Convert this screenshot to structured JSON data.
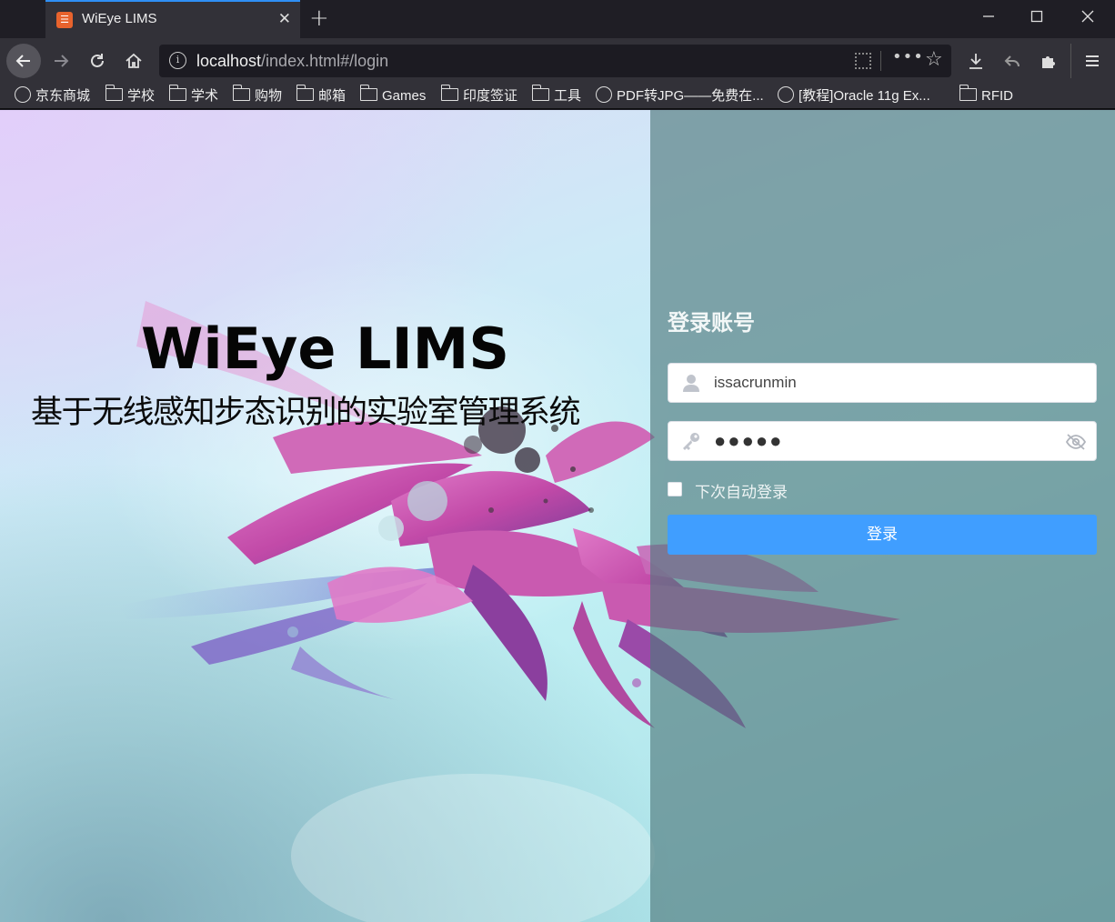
{
  "browser": {
    "tab_title": "WiEye LIMS",
    "tab_close": "✕",
    "new_tab": "+",
    "favicon_text": "☒",
    "window_controls": {
      "minimize": "—",
      "maximize": "☐",
      "close": "✕"
    },
    "url": {
      "host": "localhost",
      "path": "/index.html#/login"
    },
    "nav_icons": {
      "back": "←",
      "forward": "→",
      "reload": "↻",
      "home": "⌂",
      "more": "•••",
      "star": "☆",
      "download": "⤓",
      "undo": "↶",
      "extensions": "✚",
      "menu": "☰"
    },
    "bookmarks": [
      {
        "label": "京东商城",
        "icon": "globe-icon"
      },
      {
        "label": "学校",
        "icon": "folder-icon"
      },
      {
        "label": "学术",
        "icon": "folder-icon"
      },
      {
        "label": "购物",
        "icon": "folder-icon"
      },
      {
        "label": "邮箱",
        "icon": "folder-icon"
      },
      {
        "label": "Games",
        "icon": "folder-icon"
      },
      {
        "label": "印度签证",
        "icon": "folder-icon"
      },
      {
        "label": "工具",
        "icon": "folder-icon"
      },
      {
        "label": "PDF转JPG——免费在...",
        "icon": "globe-icon"
      },
      {
        "label": "[教程]Oracle 11g Ex...",
        "icon": "globe-icon"
      },
      {
        "label": "RFID",
        "icon": "folder-icon"
      }
    ]
  },
  "hero": {
    "title": "WiEye LIMS",
    "subtitle": "基于无线感知步态识别的实验室管理系统"
  },
  "login": {
    "heading": "登录账号",
    "username_value": "issacrunmin",
    "password_value": "●●●●●",
    "remember_label": "下次自动登录",
    "submit_label": "登录"
  },
  "colors": {
    "accent": "#409eff",
    "tab_highlight": "#2f8ff5",
    "overlay": "#50787c"
  }
}
